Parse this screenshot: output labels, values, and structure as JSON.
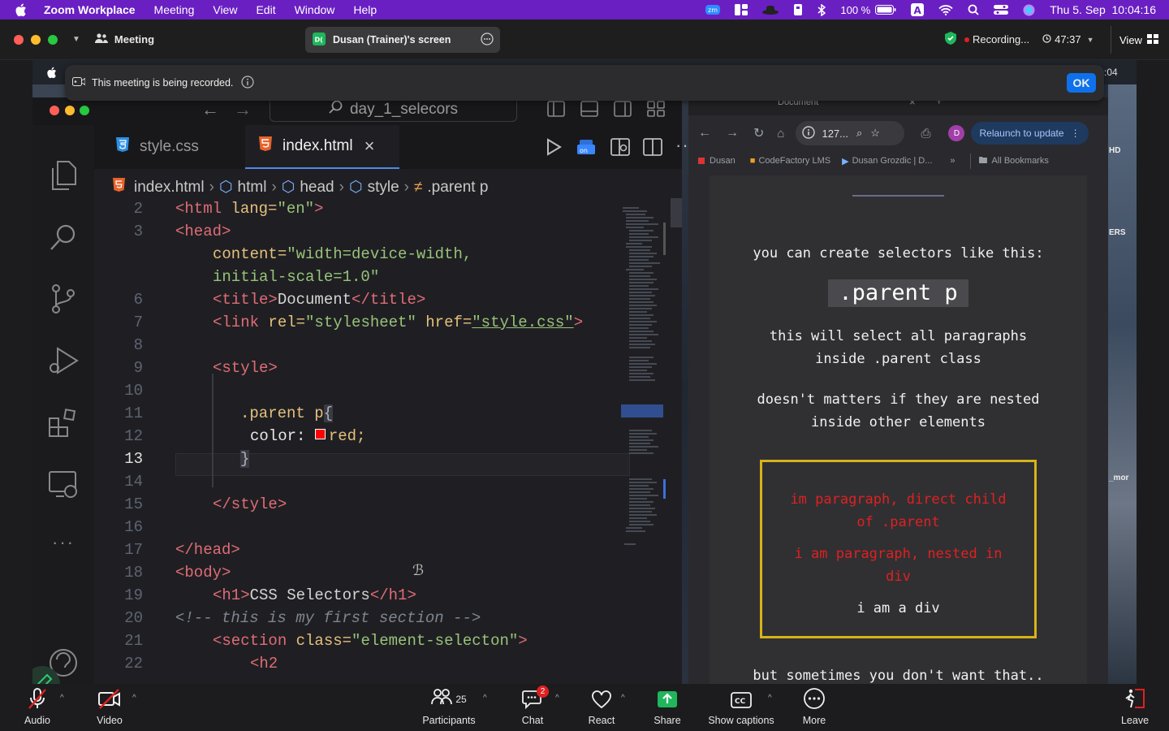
{
  "menubar": {
    "items": [
      "Zoom Workplace",
      "Meeting",
      "View",
      "Edit",
      "Window",
      "Help"
    ],
    "battery": "100 %",
    "datetime": "Thu 5. Sep  10:04:16"
  },
  "zoom": {
    "meeting_label": "Meeting",
    "share_title": "Dusan (Trainer)'s screen",
    "recording": "Recording...",
    "timer": "47:37",
    "view": "View",
    "banner_text": "This meeting is being recorded.",
    "banner_ok": "OK"
  },
  "vscode": {
    "search": "day_1_selecors",
    "tab1": "style.css",
    "tab2": "index.html",
    "crumbs": [
      "index.html",
      "html",
      "head",
      "style",
      ".parent p"
    ],
    "line_numbers": [
      "2",
      "3",
      "",
      "",
      "6",
      "7",
      "8",
      "9",
      "10",
      "11",
      "12",
      "13",
      "14",
      "15",
      "16",
      "17",
      "18",
      "19",
      "20",
      "21",
      "22"
    ],
    "code": {
      "l2a": "<html ",
      "l2b": "lang=",
      "l2c": "\"en\"",
      "l2d": ">",
      "l3": "<head>",
      "l4a": "content=",
      "l4b": "\"width=device-width,",
      "l5": "initial-scale=1.0\"",
      "l6a": "<title>",
      "l6b": "Document",
      "l6c": "</title>",
      "l7a": "<link ",
      "l7b": "rel=",
      "l7c": "\"stylesheet\"",
      "l7d": " href=",
      "l7e": "\"style.css\"",
      "l7f": ">",
      "l9": "<style>",
      "l11a": ".parent p",
      "l11b": "{",
      "l12a": "color: ",
      "l12b": "red;",
      "l13": "}",
      "l15": "</style>",
      "l17": "</head>",
      "l18": "<body>",
      "l19a": "<h1>",
      "l19b": "CSS Selectors",
      "l19c": "</h1>",
      "l20": "<!-- this is my first section -->",
      "l21a": "<section ",
      "l21b": "class=",
      "l21c": "\"element-selecton\"",
      "l21d": ">",
      "l22": "<h2"
    }
  },
  "browser": {
    "tab_title": "Document",
    "url": "127...",
    "relaunch": "Relaunch to update",
    "profile_letter": "D",
    "bookmarks": [
      "Dusan",
      "CodeFactory LMS",
      "Dusan Grozdic | D...",
      "All Bookmarks"
    ],
    "page": {
      "p1": "you can create selectors like this:",
      "code": ".parent p",
      "p2a": "this will select all paragraphs",
      "p2b": "inside .parent class",
      "p3a": "doesn't matters if they are nested",
      "p3b": "inside other elements",
      "r1a": "im paragraph, direct child",
      "r1b": "of .parent",
      "r2a": "i am paragraph, nested in",
      "r2b": "div",
      "div": "i am a div",
      "p4": "but sometimes you don't want that.."
    }
  },
  "desktop_edge": {
    "time": ":04",
    "t1": "HD",
    "t2": "ERS",
    "t3": "_mor"
  },
  "controls": {
    "audio": "Audio",
    "video": "Video",
    "participants": "Participants",
    "participants_count": "25",
    "chat": "Chat",
    "chat_badge": "2",
    "react": "React",
    "share": "Share",
    "captions": "Show captions",
    "more": "More",
    "leave": "Leave"
  },
  "colors": {
    "zoom_blue": "#0e71eb",
    "share_green": "#1fb65c",
    "menubar_purple": "#6a1fc2",
    "rec_red": "#e02020"
  }
}
